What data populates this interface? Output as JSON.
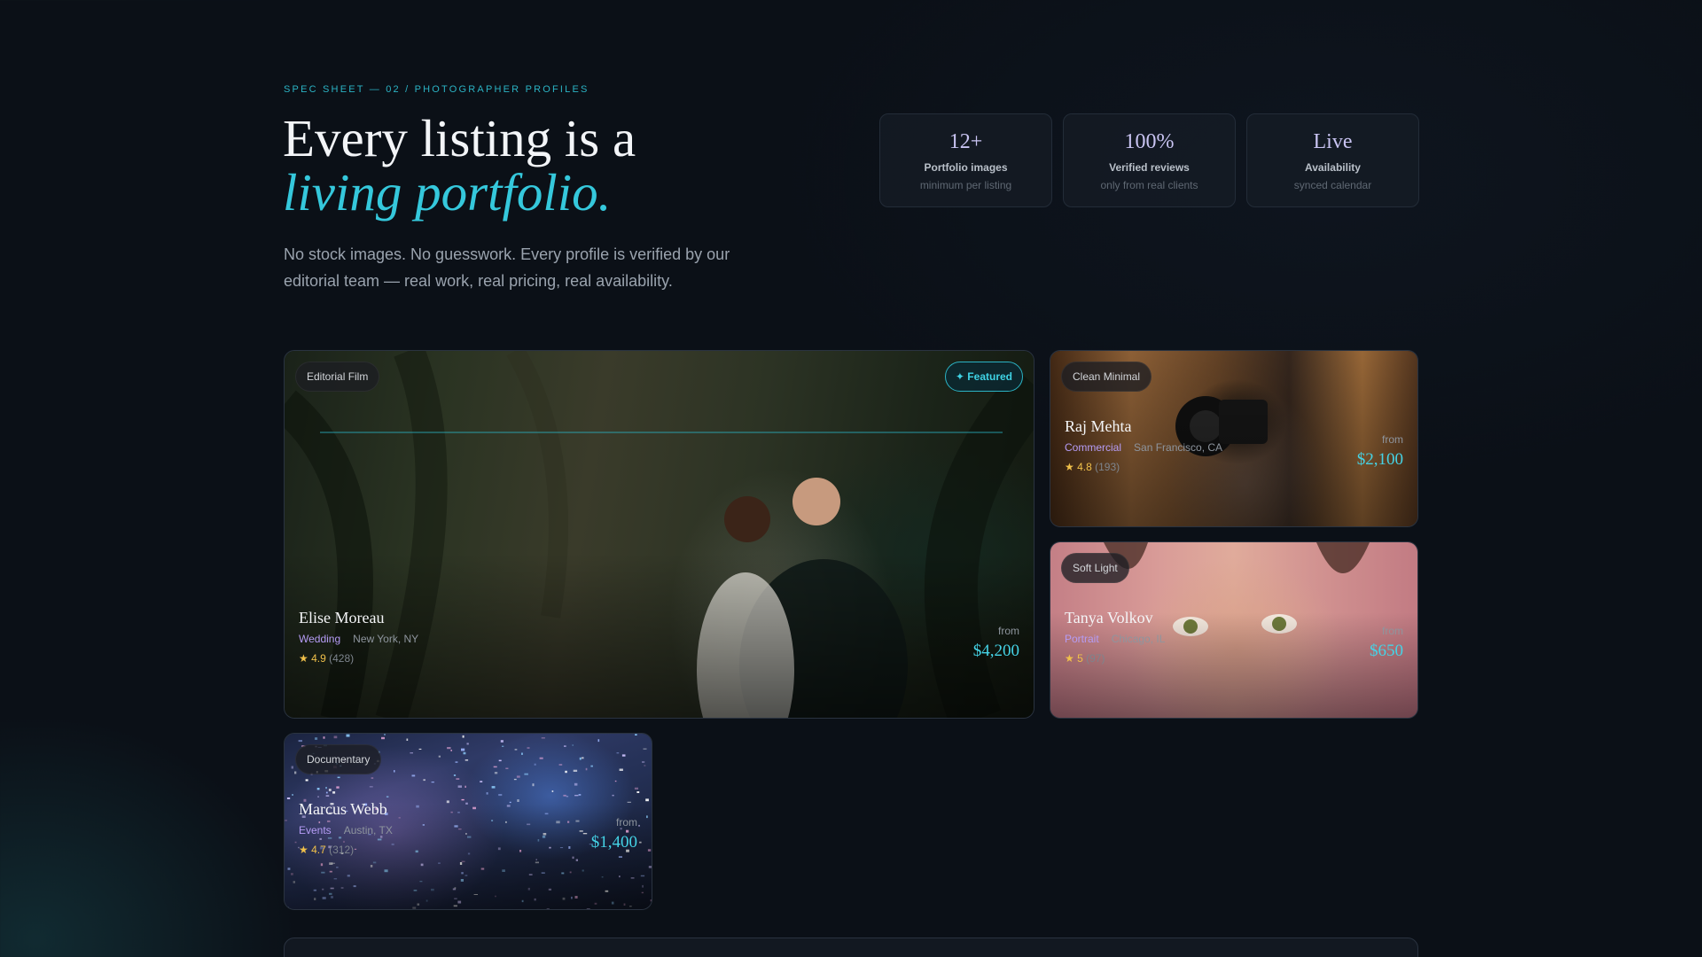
{
  "eyebrow": "SPEC SHEET — 02 / PHOTOGRAPHER PROFILES",
  "headline": {
    "line1": "Every listing is a",
    "line2": "living portfolio."
  },
  "lede": "No stock images. No guesswork. Every profile is verified by our editorial team — real work, real pricing, real availability.",
  "stats": [
    {
      "value": "12+",
      "label": "Portfolio images",
      "sub": "minimum per listing"
    },
    {
      "value": "100%",
      "label": "Verified reviews",
      "sub": "only from real clients"
    },
    {
      "value": "Live",
      "label": "Availability",
      "sub": "synced calendar"
    }
  ],
  "cards": [
    {
      "tag": "Editorial Film",
      "badge": "✦ Featured",
      "name": "Elise Moreau",
      "category": "Wedding",
      "location": "New York, NY",
      "rating": "★ 4.9",
      "reviews": "(428)",
      "from": "from",
      "price": "$4,200"
    },
    {
      "tag": "Clean Minimal",
      "name": "Raj Mehta",
      "category": "Commercial",
      "location": "San Francisco, CA",
      "rating": "★ 4.8",
      "reviews": "(193)",
      "from": "from",
      "price": "$2,100"
    },
    {
      "tag": "Soft Light",
      "name": "Tanya Volkov",
      "category": "Portrait",
      "location": "Chicago, IL",
      "rating": "★ 5",
      "reviews": "(97)",
      "from": "from",
      "price": "$650"
    },
    {
      "tag": "Documentary",
      "name": "Marcus Webb",
      "category": "Events",
      "location": "Austin, TX",
      "rating": "★ 4.7",
      "reviews": "(312)",
      "from": "from",
      "price": "$1,400"
    }
  ],
  "colors": {
    "background": "#0b1017",
    "accent": "#35c8dc",
    "category": "#b59cf5",
    "star": "#f0c04a"
  }
}
